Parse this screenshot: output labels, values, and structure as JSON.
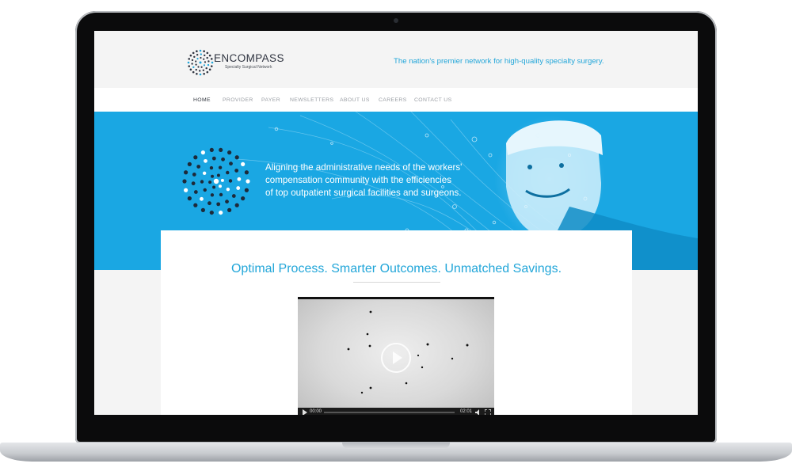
{
  "site": {
    "brand": "ENCOMPASS",
    "brand_sub": "Specialty Surgical Network",
    "tagline": "The nation's premier network for high-quality specialty surgery."
  },
  "nav": {
    "items": [
      {
        "label": "HOME",
        "active": true
      },
      {
        "label": "PROVIDER",
        "active": false
      },
      {
        "label": "PAYER",
        "active": false
      },
      {
        "label": "NEWSLETTERS",
        "active": false
      },
      {
        "label": "ABOUT US",
        "active": false
      },
      {
        "label": "CAREERS",
        "active": false
      },
      {
        "label": "CONTACT US",
        "active": false
      }
    ]
  },
  "hero": {
    "line1": "Aligning the administrative needs of the workers'",
    "line2": "compensation community with the efficiencies",
    "line3": "of top outpatient surgical facilities and surgeons."
  },
  "main": {
    "headline": "Optimal Process. Smarter Outcomes. Unmatched Savings."
  },
  "video": {
    "current_time": "00:00",
    "duration": "02:01",
    "progress": 0.0,
    "play_icon": "play-icon",
    "fullscreen_icon": "fullscreen-icon",
    "volume_icon": "volume-icon"
  },
  "colors": {
    "accent": "#22a6d9",
    "hero_bg": "#1aa7e3",
    "text_dark": "#333840",
    "nav_gray": "#9a9ea4"
  }
}
